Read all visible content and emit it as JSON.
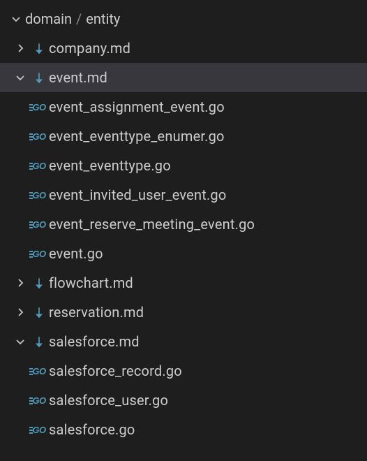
{
  "colors": {
    "accent": "#519aba",
    "background": "#1e1e1e",
    "selected": "#37373d",
    "foreground": "#cccccc",
    "muted": "#8a8a8a"
  },
  "root": {
    "seg1": "domain",
    "sep": "/",
    "seg2": "entity",
    "expanded": true
  },
  "items": [
    {
      "kind": "md",
      "label": "company.md",
      "expanded": false,
      "depth": 1,
      "selected": false
    },
    {
      "kind": "md",
      "label": "event.md",
      "expanded": true,
      "depth": 1,
      "selected": true
    },
    {
      "kind": "go",
      "label": "event_assignment_event.go",
      "depth": 2
    },
    {
      "kind": "go",
      "label": "event_eventtype_enumer.go",
      "depth": 2
    },
    {
      "kind": "go",
      "label": "event_eventtype.go",
      "depth": 2
    },
    {
      "kind": "go",
      "label": "event_invited_user_event.go",
      "depth": 2
    },
    {
      "kind": "go",
      "label": "event_reserve_meeting_event.go",
      "depth": 2
    },
    {
      "kind": "go",
      "label": "event.go",
      "depth": 2
    },
    {
      "kind": "md",
      "label": "flowchart.md",
      "expanded": false,
      "depth": 1,
      "selected": false
    },
    {
      "kind": "md",
      "label": "reservation.md",
      "expanded": false,
      "depth": 1,
      "selected": false
    },
    {
      "kind": "md",
      "label": "salesforce.md",
      "expanded": true,
      "depth": 1,
      "selected": false
    },
    {
      "kind": "go",
      "label": "salesforce_record.go",
      "depth": 2
    },
    {
      "kind": "go",
      "label": "salesforce_user.go",
      "depth": 2
    },
    {
      "kind": "go",
      "label": "salesforce.go",
      "depth": 2
    }
  ],
  "icons": {
    "go_text": "GO"
  }
}
